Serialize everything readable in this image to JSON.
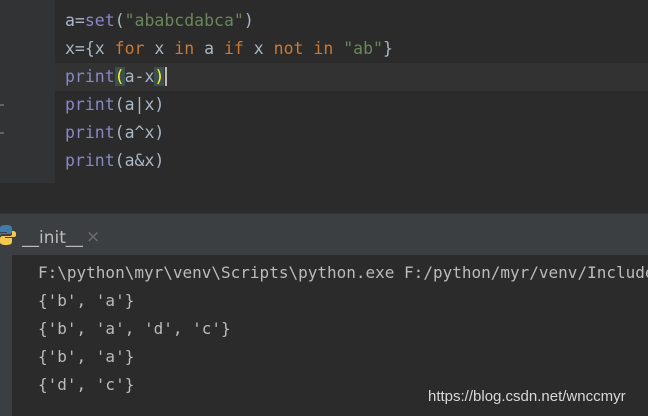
{
  "editor": {
    "lines": [
      [
        {
          "t": "a="
        },
        {
          "t": "set",
          "c": "bi"
        },
        {
          "t": "("
        },
        {
          "t": "\"ababcdabca\"",
          "c": "str"
        },
        {
          "t": ")"
        }
      ],
      [
        {
          "t": "x={x "
        },
        {
          "t": "for",
          "c": "kw"
        },
        {
          "t": " x "
        },
        {
          "t": "in",
          "c": "kw"
        },
        {
          "t": " a "
        },
        {
          "t": "if",
          "c": "kw"
        },
        {
          "t": " x "
        },
        {
          "t": "not in",
          "c": "kw"
        },
        {
          "t": " "
        },
        {
          "t": "\"ab\"",
          "c": "str"
        },
        {
          "t": "}"
        }
      ],
      [
        {
          "t": "print",
          "c": "bi"
        },
        {
          "t": "(",
          "c": "brace-match"
        },
        {
          "t": "a-x"
        },
        {
          "t": ")",
          "c": "brace-match"
        },
        {
          "caret": true
        }
      ],
      [
        {
          "t": "print",
          "c": "bi"
        },
        {
          "t": "(a|x)"
        }
      ],
      [
        {
          "t": "print",
          "c": "bi"
        },
        {
          "t": "(a^x)"
        }
      ],
      [
        {
          "t": "print",
          "c": "bi"
        },
        {
          "t": "(a&x)"
        }
      ]
    ]
  },
  "run_panel": {
    "tab_name": "__init__",
    "close_glyph": "×",
    "command": "F:\\python\\myr\\venv\\Scripts\\python.exe F:/python/myr/venv/Include",
    "output": [
      "{'b', 'a'}",
      "{'b', 'a', 'd', 'c'}",
      "{'b', 'a'}",
      "{'d', 'c'}"
    ]
  },
  "watermark": "https://blog.csdn.net/wnccmyr",
  "colors": {
    "background": "#2b2b2b",
    "keyword": "#cc7832",
    "string": "#6a8759",
    "builtin": "#8888c6",
    "default_text": "#a9b7c6",
    "brace_match": "#ffef28"
  },
  "icons": {
    "tab_icon": "python-icon",
    "close_icon": "close-icon"
  }
}
